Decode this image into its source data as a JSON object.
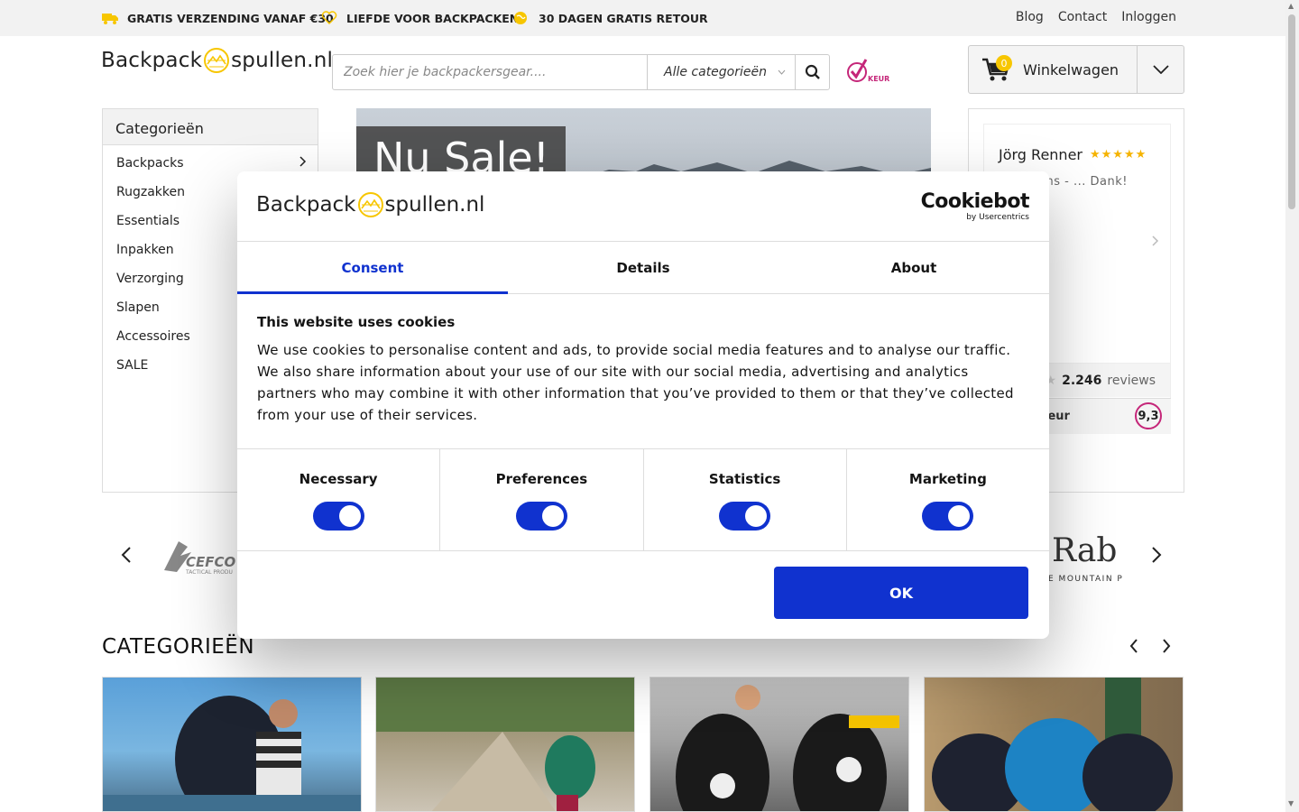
{
  "topbar": {
    "usps": [
      "GRATIS VERZENDING VANAF €30",
      "LIEFDE VOOR BACKPACKEN!",
      "30 DAGEN GRATIS RETOUR"
    ],
    "links": [
      "Blog",
      "Contact",
      "Inloggen"
    ]
  },
  "header": {
    "logo_left": "Backpack",
    "logo_right": "spullen.nl",
    "search_placeholder": "Zoek hier je backpackersgear....",
    "category_select": "Alle categorieën",
    "cart_label": "Winkelwagen",
    "cart_count": "0",
    "keur_label": "KEUR"
  },
  "sidebar": {
    "title": "Categorieën",
    "items": [
      "Backpacks",
      "Rugzakken",
      "Essentials",
      "Inpakken",
      "Verzorging",
      "Slapen",
      "Accessoires",
      "SALE"
    ]
  },
  "hero": {
    "banner": "Nu Sale!"
  },
  "reviews": {
    "name": "Jörg Renner",
    "text": "...bestens - ... Dank!",
    "rating_stars": 5,
    "count": "2.246",
    "count_label": "reviews",
    "winkelkeur": "...nkelKeur",
    "score": "9,3"
  },
  "brands": {
    "left": "CEFCO",
    "left_sub": "TACTICAL PRODU",
    "right": "Rab",
    "right_sub": "E MOUNTAIN PEOPLE"
  },
  "categories": {
    "title": "CATEGORIEËN"
  },
  "cookie_dialog": {
    "logo_left": "Backpack",
    "logo_right": "spullen.nl",
    "brand": "Cookiebot",
    "brand_sub": "by Usercentrics",
    "tabs": [
      "Consent",
      "Details",
      "About"
    ],
    "heading": "This website uses cookies",
    "body": "We use cookies to personalise content and ads, to provide social media features and to analyse our traffic. We also share information about your use of our site with our social media, advertising and analytics partners who may combine it with other information that you’ve provided to them or that they’ve collected from your use of their services.",
    "toggles": [
      {
        "label": "Necessary",
        "on": true
      },
      {
        "label": "Preferences",
        "on": true
      },
      {
        "label": "Statistics",
        "on": true
      },
      {
        "label": "Marketing",
        "on": true
      }
    ],
    "ok_label": "OK"
  },
  "colors": {
    "accent": "#1032cf",
    "brand_yellow": "#f7c600",
    "keur_pink": "#c52679"
  }
}
